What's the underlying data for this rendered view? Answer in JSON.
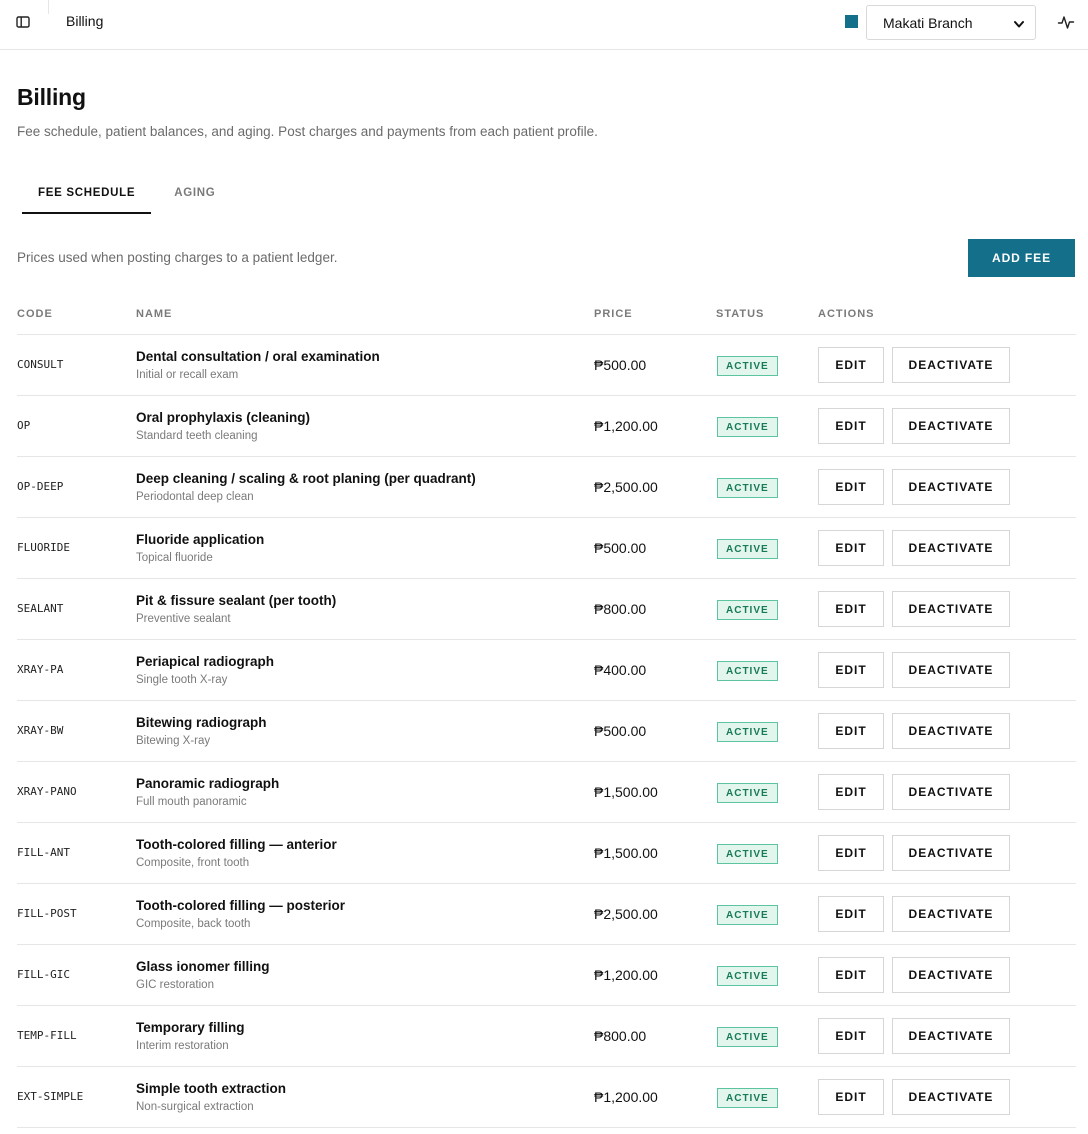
{
  "topbar": {
    "title": "Billing",
    "branch": "Makati Branch",
    "branch_color": "#14708a"
  },
  "header": {
    "title": "Billing",
    "subtitle": "Fee schedule, patient balances, and aging. Post charges and payments from each patient profile."
  },
  "tabs": [
    {
      "label": "FEE SCHEDULE",
      "active": true
    },
    {
      "label": "AGING",
      "active": false
    }
  ],
  "toolbar": {
    "description": "Prices used when posting charges to a patient ledger.",
    "add_label": "ADD FEE"
  },
  "table": {
    "columns": {
      "code": "CODE",
      "name": "NAME",
      "price": "PRICE",
      "status": "STATUS",
      "actions": "ACTIONS"
    },
    "edit_label": "EDIT",
    "deactivate_label": "DEACTIVATE",
    "rows": [
      {
        "code": "CONSULT",
        "name": "Dental consultation / oral examination",
        "desc": "Initial or recall exam",
        "price": "₱500.00",
        "status": "ACTIVE"
      },
      {
        "code": "OP",
        "name": "Oral prophylaxis (cleaning)",
        "desc": "Standard teeth cleaning",
        "price": "₱1,200.00",
        "status": "ACTIVE"
      },
      {
        "code": "OP-DEEP",
        "name": "Deep cleaning / scaling & root planing (per quadrant)",
        "desc": "Periodontal deep clean",
        "price": "₱2,500.00",
        "status": "ACTIVE"
      },
      {
        "code": "FLUORIDE",
        "name": "Fluoride application",
        "desc": "Topical fluoride",
        "price": "₱500.00",
        "status": "ACTIVE"
      },
      {
        "code": "SEALANT",
        "name": "Pit & fissure sealant (per tooth)",
        "desc": "Preventive sealant",
        "price": "₱800.00",
        "status": "ACTIVE"
      },
      {
        "code": "XRAY-PA",
        "name": "Periapical radiograph",
        "desc": "Single tooth X-ray",
        "price": "₱400.00",
        "status": "ACTIVE"
      },
      {
        "code": "XRAY-BW",
        "name": "Bitewing radiograph",
        "desc": "Bitewing X-ray",
        "price": "₱500.00",
        "status": "ACTIVE"
      },
      {
        "code": "XRAY-PANO",
        "name": "Panoramic radiograph",
        "desc": "Full mouth panoramic",
        "price": "₱1,500.00",
        "status": "ACTIVE"
      },
      {
        "code": "FILL-ANT",
        "name": "Tooth-colored filling — anterior",
        "desc": "Composite, front tooth",
        "price": "₱1,500.00",
        "status": "ACTIVE"
      },
      {
        "code": "FILL-POST",
        "name": "Tooth-colored filling — posterior",
        "desc": "Composite, back tooth",
        "price": "₱2,500.00",
        "status": "ACTIVE"
      },
      {
        "code": "FILL-GIC",
        "name": "Glass ionomer filling",
        "desc": "GIC restoration",
        "price": "₱1,200.00",
        "status": "ACTIVE"
      },
      {
        "code": "TEMP-FILL",
        "name": "Temporary filling",
        "desc": "Interim restoration",
        "price": "₱800.00",
        "status": "ACTIVE"
      },
      {
        "code": "EXT-SIMPLE",
        "name": "Simple tooth extraction",
        "desc": "Non-surgical extraction",
        "price": "₱1,200.00",
        "status": "ACTIVE"
      }
    ]
  }
}
